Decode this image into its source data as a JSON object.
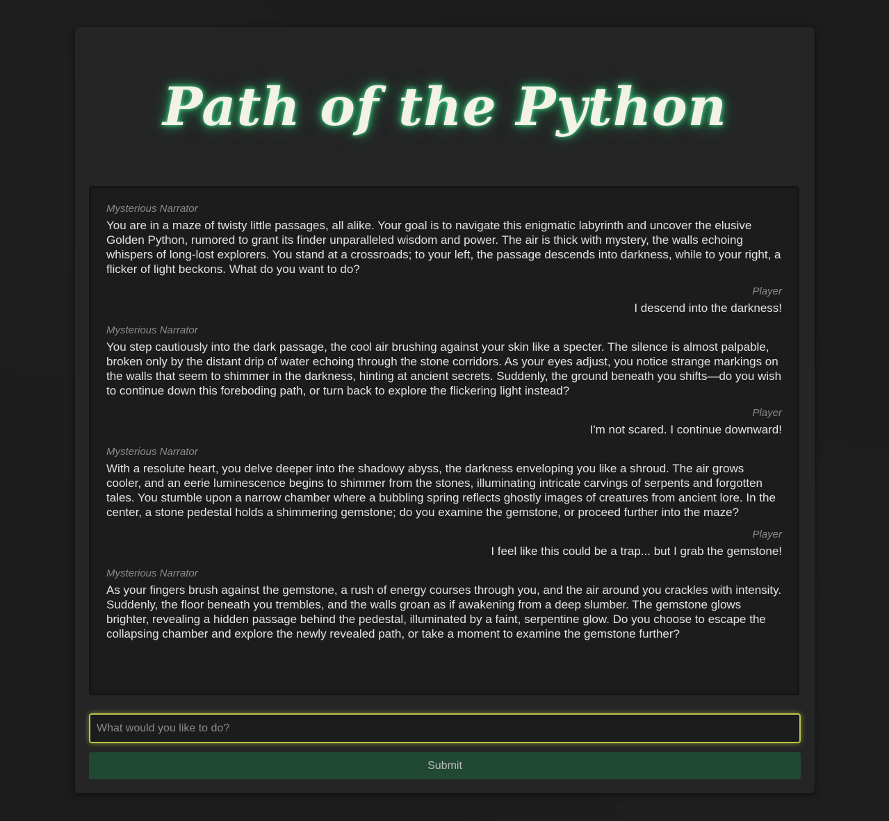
{
  "header": {
    "title": "Path of the Python"
  },
  "chat": {
    "messages": [
      {
        "role": "narrator",
        "speaker": "Mysterious Narrator",
        "text": "You are in a maze of twisty little passages, all alike. Your goal is to navigate this enigmatic labyrinth and uncover the elusive Golden Python, rumored to grant its finder unparalleled wisdom and power. The air is thick with mystery, the walls echoing whispers of long-lost explorers. You stand at a crossroads; to your left, the passage descends into darkness, while to your right, a flicker of light beckons. What do you want to do?"
      },
      {
        "role": "player",
        "speaker": "Player",
        "text": "I descend into the darkness!"
      },
      {
        "role": "narrator",
        "speaker": "Mysterious Narrator",
        "text": "You step cautiously into the dark passage, the cool air brushing against your skin like a specter. The silence is almost palpable, broken only by the distant drip of water echoing through the stone corridors. As your eyes adjust, you notice strange markings on the walls that seem to shimmer in the darkness, hinting at ancient secrets. Suddenly, the ground beneath you shifts—do you wish to continue down this foreboding path, or turn back to explore the flickering light instead?"
      },
      {
        "role": "player",
        "speaker": "Player",
        "text": "I'm not scared. I continue downward!"
      },
      {
        "role": "narrator",
        "speaker": "Mysterious Narrator",
        "text": "With a resolute heart, you delve deeper into the shadowy abyss, the darkness enveloping you like a shroud. The air grows cooler, and an eerie luminescence begins to shimmer from the stones, illuminating intricate carvings of serpents and forgotten tales. You stumble upon a narrow chamber where a bubbling spring reflects ghostly images of creatures from ancient lore. In the center, a stone pedestal holds a shimmering gemstone; do you examine the gemstone, or proceed further into the maze?"
      },
      {
        "role": "player",
        "speaker": "Player",
        "text": "I feel like this could be a trap... but I grab the gemstone!"
      },
      {
        "role": "narrator",
        "speaker": "Mysterious Narrator",
        "text": "As your fingers brush against the gemstone, a rush of energy courses through you, and the air around you crackles with intensity. Suddenly, the floor beneath you trembles, and the walls groan as if awakening from a deep slumber. The gemstone glows brighter, revealing a hidden passage behind the pedestal, illuminated by a faint, serpentine glow. Do you choose to escape the collapsing chamber and explore the newly revealed path, or take a moment to examine the gemstone further?"
      }
    ]
  },
  "input": {
    "value": "",
    "placeholder": "What would you like to do?"
  },
  "submit": {
    "label": "Submit"
  },
  "colors": {
    "page_background": "#1c1c1c",
    "card_background": "#252526",
    "title_glow": "#46dc8c",
    "input_border": "#b9c24a",
    "submit_background": "#214835"
  }
}
